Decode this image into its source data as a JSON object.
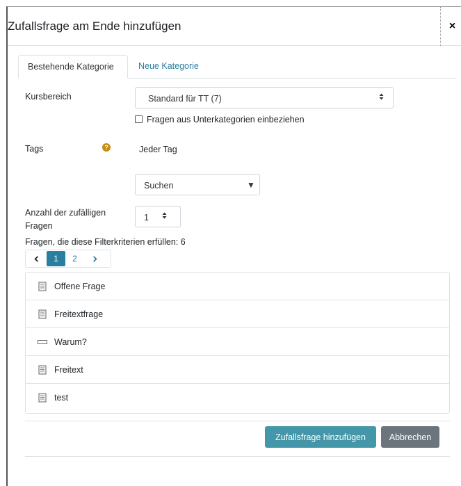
{
  "modal": {
    "title": "Zufallsfrage am Ende hinzufügen",
    "close_symbol": "×"
  },
  "tabs": [
    {
      "label": "Bestehende Kategorie",
      "active": true
    },
    {
      "label": "Neue Kategorie",
      "active": false
    }
  ],
  "form": {
    "category_label": "Kursbereich",
    "category_value": "Standard für TT (7)",
    "subcategories_label": "Fragen aus Unterkategorien einbeziehen",
    "subcategories_checked": false,
    "tags_label": "Tags",
    "tags_help_symbol": "?",
    "tags_value": "Jeder Tag",
    "tags_search_placeholder": "Suchen",
    "count_label": "Anzahl der zufälligen Fragen",
    "count_value": "1"
  },
  "results": {
    "summary": "Fragen, die diese Filterkriterien erfüllen: 6",
    "pages": [
      "1",
      "2"
    ],
    "current_page": "1",
    "questions": [
      {
        "label": "Offene Frage",
        "icon": "essay-question-icon"
      },
      {
        "label": "Freitextfrage",
        "icon": "essay-question-icon"
      },
      {
        "label": "Warum?",
        "icon": "short-answer-icon"
      },
      {
        "label": "Freitext",
        "icon": "essay-question-icon"
      },
      {
        "label": "test",
        "icon": "essay-question-icon"
      }
    ]
  },
  "footer": {
    "add_label": "Zufallsfrage hinzufügen",
    "cancel_label": "Abbrechen"
  },
  "colors": {
    "link": "#2a7fa0",
    "primary_button": "#4397a9",
    "secondary_button": "#6c757d",
    "help_icon": "#c58b12"
  }
}
